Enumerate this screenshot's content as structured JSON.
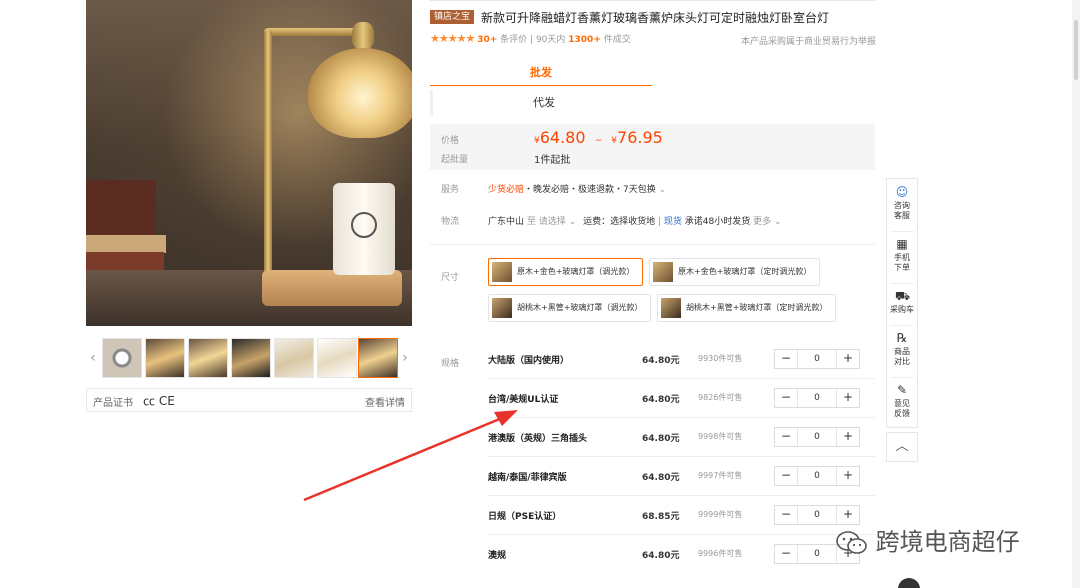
{
  "product": {
    "store_tag": "镇店之宝",
    "title": "新款可升降融蜡灯香薰灯玻璃香薰炉床头灯可定时融烛灯卧室台灯",
    "stars": "★★★★★",
    "reviews_count": "30+",
    "reviews_label": "条评价",
    "sales_period": "90天内",
    "sales_count": "1300+",
    "sales_label": "件成交",
    "behavior_note": "本产品采购属于商业贸易行为",
    "report": "举报"
  },
  "tabs": [
    {
      "label": "批发"
    },
    {
      "label": "代发"
    }
  ],
  "price": {
    "label": "价格",
    "currency": "¥",
    "low": "64.80",
    "tilde": "~",
    "high": "76.95",
    "moq_label": "起批量",
    "moq_value": "1件起批"
  },
  "service": {
    "label": "服务",
    "highlight": "少货必赔",
    "rest": "・晚发必赔・极速退款・7天包换",
    "chevron": "⌄"
  },
  "logistics": {
    "label": "物流",
    "origin": "广东中山",
    "to": "至",
    "select": "请选择",
    "fee": "运费：选择收货地",
    "stock_tag": "现货",
    "promise": "承诺48小时发货",
    "more": "更多"
  },
  "size": {
    "label": "尺寸",
    "options": [
      {
        "label": "原木+金色+玻璃灯罩（调光款）"
      },
      {
        "label": "原木+金色+玻璃灯罩（定时调光款）"
      },
      {
        "label": "胡桃木+黑管+玻璃灯罩（调光款）"
      },
      {
        "label": "胡桃木+黑管+玻璃灯罩（定时调光款）"
      }
    ]
  },
  "spec": {
    "label": "规格",
    "rows": [
      {
        "name": "大陆版（国内使用）",
        "price": "64.80元",
        "stock": "9930件可售",
        "qty": "0"
      },
      {
        "name": "台湾/美规UL认证",
        "price": "64.80元",
        "stock": "9826件可售",
        "qty": "0"
      },
      {
        "name": "港澳版（英规）三角插头",
        "price": "64.80元",
        "stock": "9998件可售",
        "qty": "0"
      },
      {
        "name": "越南/泰国/菲律宾版",
        "price": "64.80元",
        "stock": "9997件可售",
        "qty": "0"
      },
      {
        "name": "日规（PSE认证）",
        "price": "68.85元",
        "stock": "9999件可售",
        "qty": "0"
      },
      {
        "name": "澳规",
        "price": "64.80元",
        "stock": "9996件可售",
        "qty": "0"
      }
    ],
    "minus": "−",
    "plus": "+"
  },
  "gallery": {
    "prev": "‹",
    "next": "›",
    "cert_label": "产品证书",
    "cert_icons": "㏄ CE",
    "cert_detail": "查看详情"
  },
  "sidebar": {
    "items": [
      {
        "icon": "☺",
        "label1": "咨询",
        "label2": "客服"
      },
      {
        "icon": "▦",
        "label1": "手机",
        "label2": "下单"
      },
      {
        "icon": "⛟",
        "label1": "采购车",
        "label2": ""
      },
      {
        "icon": "℞",
        "label1": "商品",
        "label2": "对比"
      },
      {
        "icon": "✎",
        "label1": "意见",
        "label2": "反馈"
      }
    ],
    "top": "︿"
  },
  "watermark": {
    "text": "跨境电商超仔"
  },
  "colors": {
    "accent": "#ff6a00",
    "price": "#ff4400",
    "arrow": "#e8322a"
  }
}
